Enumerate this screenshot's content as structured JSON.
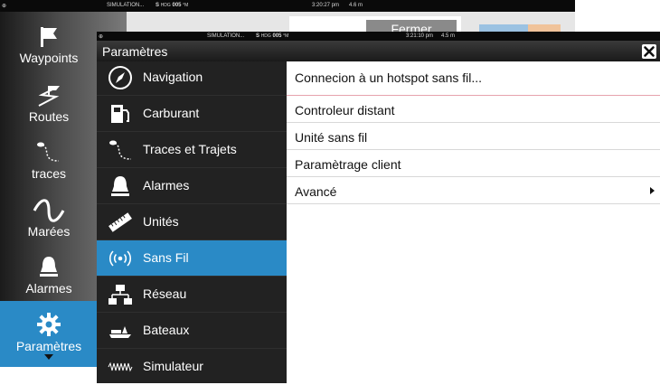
{
  "back_status": {
    "sim": "SIMULATION...",
    "hdg_prefix": "S",
    "hdg_label": "HDG",
    "hdg_value": "005",
    "hdg_unit": "°M",
    "time": "3:20:27 pm",
    "depth": "4.6 m"
  },
  "back_button": "Fermer",
  "sidebar": {
    "items": [
      {
        "label": "Waypoints",
        "icon": "flag-icon"
      },
      {
        "label": "Routes",
        "icon": "route-icon"
      },
      {
        "label": "traces",
        "icon": "trail-icon"
      },
      {
        "label": "Marées",
        "icon": "tide-icon"
      },
      {
        "label": "Alarmes",
        "icon": "bell-icon"
      },
      {
        "label": "Paramètres",
        "icon": "gear-icon"
      }
    ]
  },
  "dialog_status": {
    "sim": "SIMULATION...",
    "hdg_prefix": "S",
    "hdg_label": "HDG",
    "hdg_value": "005",
    "hdg_unit": "°M",
    "time": "3:21:10 pm",
    "depth": "4.5 m"
  },
  "dialog": {
    "title": "Paramètres"
  },
  "menu": {
    "items": [
      {
        "label": "Navigation",
        "icon": "compass-icon"
      },
      {
        "label": "Carburant",
        "icon": "fuel-pump-icon"
      },
      {
        "label": "Traces et Trajets",
        "icon": "trail-icon"
      },
      {
        "label": "Alarmes",
        "icon": "bell-icon"
      },
      {
        "label": "Unités",
        "icon": "ruler-icon"
      },
      {
        "label": "Sans Fil",
        "icon": "wireless-icon"
      },
      {
        "label": "Réseau",
        "icon": "network-icon"
      },
      {
        "label": "Bateaux",
        "icon": "boat-icon"
      },
      {
        "label": "Simulateur",
        "icon": "waveform-icon"
      }
    ],
    "active_index": 5
  },
  "options": [
    {
      "label": "Connecion à un hotspot sans fil..."
    },
    {
      "label": "Controleur distant"
    },
    {
      "label": "Unité sans fil"
    },
    {
      "label": "Paramètrage client"
    },
    {
      "label": "Avancé"
    }
  ],
  "colors": {
    "accent": "#2a8ac6",
    "menu_bg": "#222222",
    "title_bg": "#1a1a1a"
  }
}
